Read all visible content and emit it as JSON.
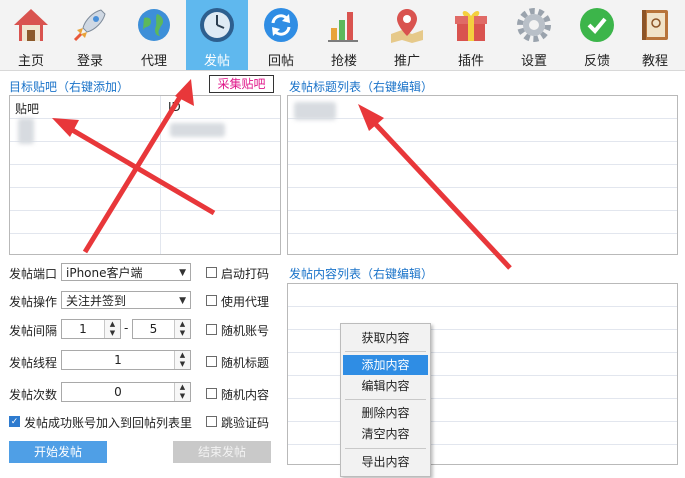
{
  "toolbar": {
    "items": [
      {
        "label": "主页",
        "icon": "home-icon"
      },
      {
        "label": "登录",
        "icon": "rocket-icon"
      },
      {
        "label": "代理",
        "icon": "globe-icon"
      },
      {
        "label": "发帖",
        "icon": "clock-icon",
        "active": true
      },
      {
        "label": "回帖",
        "icon": "refresh-icon"
      },
      {
        "label": "抢楼",
        "icon": "bar-chart-icon"
      },
      {
        "label": "推广",
        "icon": "map-pin-icon"
      },
      {
        "label": "插件",
        "icon": "gift-icon"
      },
      {
        "label": "设置",
        "icon": "gear-icon"
      },
      {
        "label": "反馈",
        "icon": "check-circle-icon"
      },
      {
        "label": "教程",
        "icon": "book-icon"
      }
    ]
  },
  "target_bars": {
    "label": "目标贴吧（右键添加）",
    "collect_button": "采集贴吧",
    "col_name": "贴吧",
    "col_id": "ID"
  },
  "title_list": {
    "label": "发帖标题列表（右键编辑）"
  },
  "content_list": {
    "label": "发帖内容列表（右键编辑）"
  },
  "form": {
    "port_label": "发帖端口",
    "port_value": "iPhone客户端",
    "action_label": "发帖操作",
    "action_value": "关注并签到",
    "interval_label": "发帖间隔",
    "interval_min": "1",
    "interval_sep": "-",
    "interval_max": "5",
    "threads_label": "发帖线程",
    "threads_value": "1",
    "count_label": "发帖次数",
    "count_value": "0"
  },
  "options": {
    "captcha": "启动打码",
    "use_proxy": "使用代理",
    "random_account": "随机账号",
    "random_title": "随机标题",
    "random_content": "随机内容",
    "skip_verify": "跳验证码",
    "add_to_reply": "发帖成功账号加入到回帖列表里"
  },
  "buttons": {
    "start": "开始发帖",
    "stop": "结束发帖"
  },
  "context_menu": {
    "get": "获取内容",
    "add": "添加内容",
    "edit": "编辑内容",
    "delete": "删除内容",
    "clear": "清空内容",
    "export": "导出内容"
  },
  "colors": {
    "accent": "#5fb8ee",
    "link": "#1a73c9",
    "arrow": "#e8373a",
    "highlight": "#2f8de4"
  }
}
